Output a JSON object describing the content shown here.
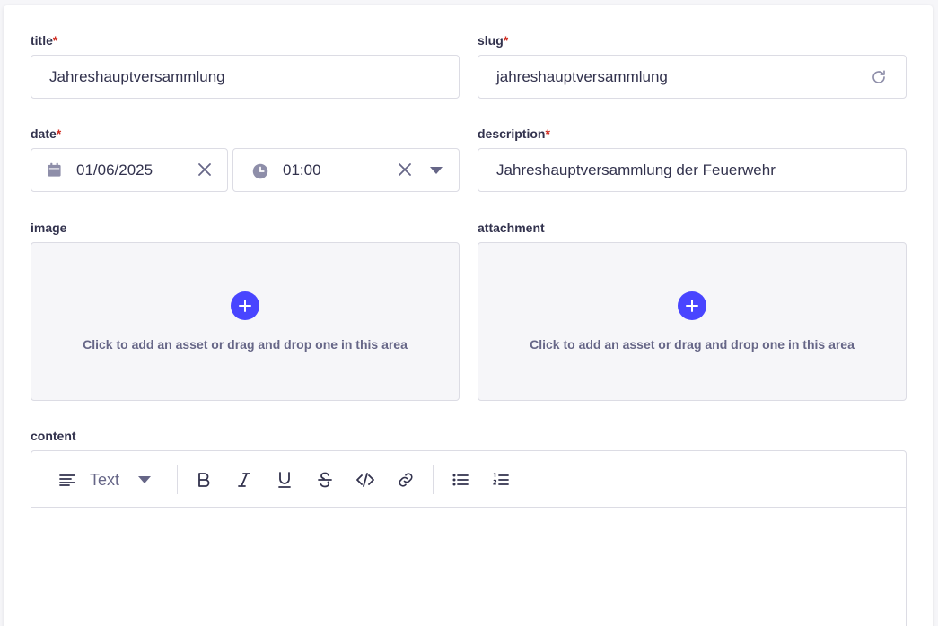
{
  "fields": {
    "title": {
      "label": "title",
      "required_mark": "*",
      "value": "Jahreshauptversammlung"
    },
    "slug": {
      "label": "slug",
      "required_mark": "*",
      "value": "jahreshauptversammlung",
      "action_icon": "refresh-icon"
    },
    "date": {
      "label": "date",
      "required_mark": "*",
      "date_value": "01/06/2025",
      "time_value": "01:00"
    },
    "description": {
      "label": "description",
      "required_mark": "*",
      "value": "Jahreshauptversammlung der Feuerwehr"
    },
    "image": {
      "label": "image",
      "dropzone_text": "Click to add an asset or drag and drop one in this area"
    },
    "attachment": {
      "label": "attachment",
      "dropzone_text": "Click to add an asset or drag and drop one in this area"
    },
    "content": {
      "label": "content",
      "block_type": "Text",
      "toolbar_icons": [
        "paragraph-align-icon",
        "bold-icon",
        "italic-icon",
        "underline-icon",
        "strikethrough-icon",
        "code-icon",
        "link-icon",
        "bulleted-list-icon",
        "numbered-list-icon"
      ]
    }
  },
  "colors": {
    "accent": "#4945ff",
    "required": "#d02b20",
    "border": "#dcdce4",
    "muted_text": "#666687",
    "icon": "#8e8ea9"
  }
}
